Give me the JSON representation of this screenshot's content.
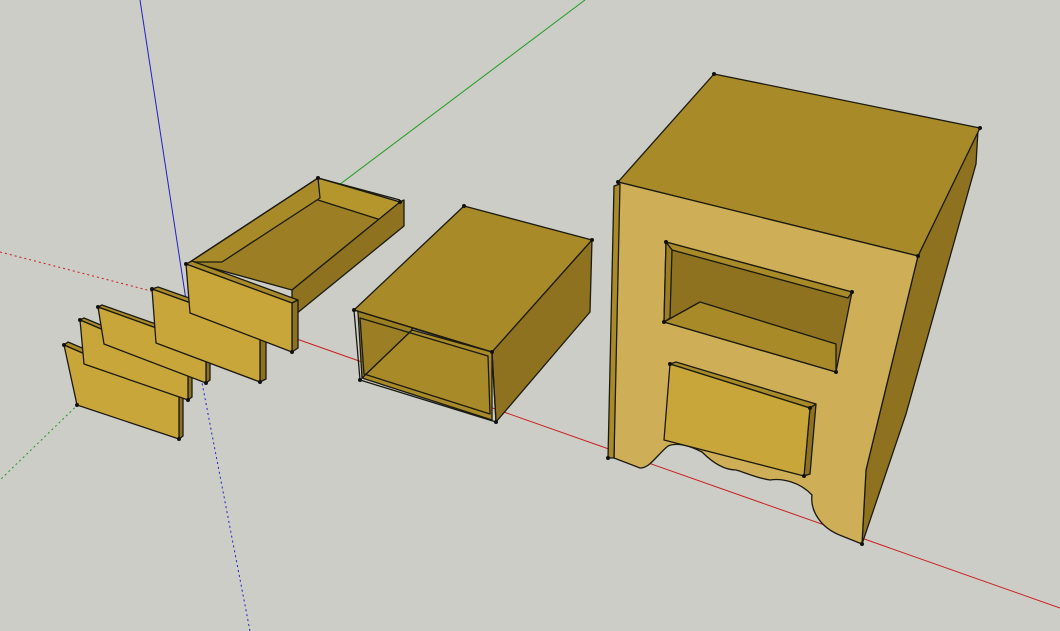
{
  "viewport": {
    "background": "#cdcdc8",
    "axes": {
      "red": "#c82020",
      "green": "#1f9a1f",
      "blue": "#2020c8"
    }
  },
  "materials": {
    "face_top": "#a88a28",
    "face_front": "#c9a63a",
    "face_side": "#8e7220",
    "face_light": "#cfae58",
    "face_inner": "#9c7f24",
    "edge": "#1a1a10"
  },
  "model": {
    "components": [
      "drawer-front-panel",
      "drawer-front-panel",
      "drawer-front-panel",
      "drawer-front-panel",
      "drawer-front-panel",
      "open-drawer-box",
      "carcass-box",
      "nightstand-cabinet"
    ]
  }
}
